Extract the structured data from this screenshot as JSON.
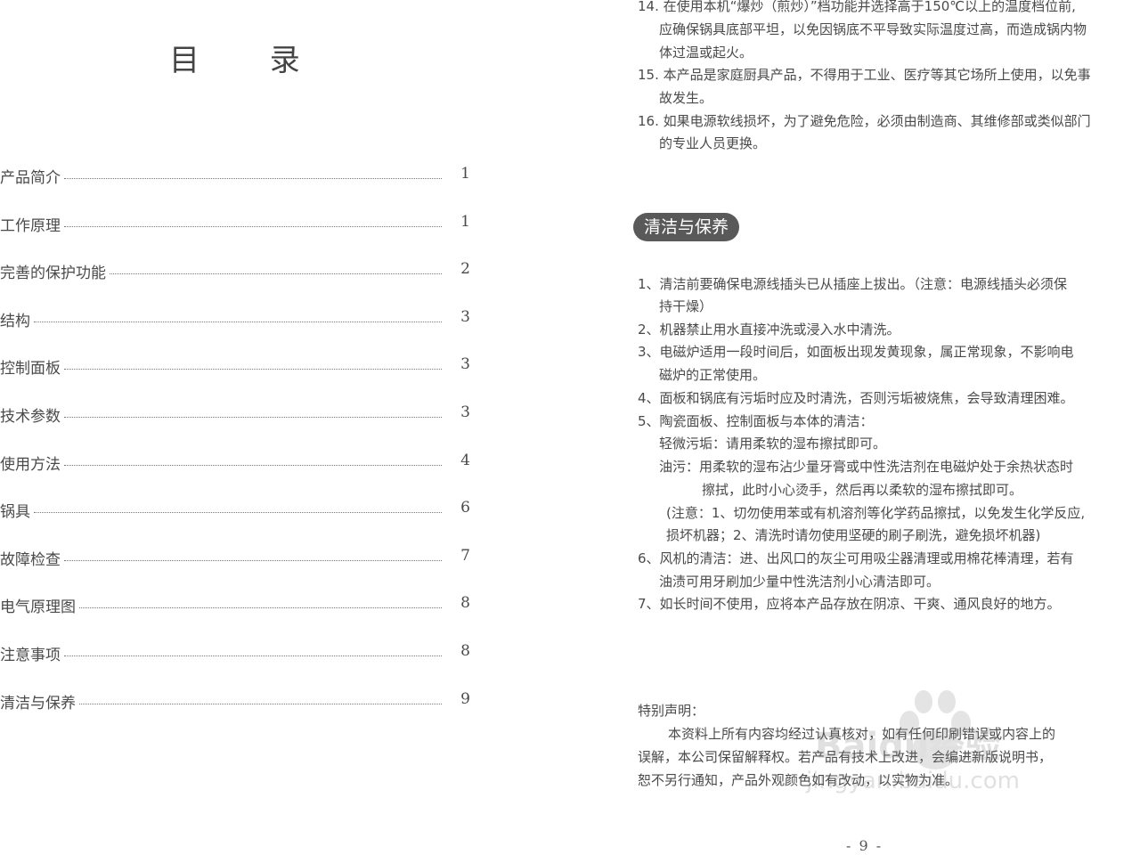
{
  "toc": {
    "title": "目 录",
    "entries": [
      {
        "label": "产品简介",
        "page": "1"
      },
      {
        "label": "工作原理",
        "page": "1"
      },
      {
        "label": "完善的保护功能",
        "page": "2"
      },
      {
        "label": "结构",
        "page": "3"
      },
      {
        "label": "控制面板",
        "page": "3"
      },
      {
        "label": "技术参数",
        "page": "3"
      },
      {
        "label": "使用方法",
        "page": "4"
      },
      {
        "label": "锅具",
        "page": "6"
      },
      {
        "label": "故障检查",
        "page": "7"
      },
      {
        "label": "电气原理图",
        "page": "8"
      },
      {
        "label": "注意事项",
        "page": "8"
      },
      {
        "label": "清洁与保养",
        "page": "9"
      }
    ]
  },
  "right": {
    "top_lines": [
      "14. 在使用本机“爆炒（煎炒）”档功能并选择高于150℃以上的温度档位前,",
      "应确保锅具底部平坦，以免因锅底不平导致实际温度过高，而造成锅内物",
      "体过温或起火。",
      "15. 本产品是家庭厨具产品，不得用于工业、医疗等其它场所上使用，以免事",
      "故发生。",
      "16. 如果电源软线损坏，为了避免危险，必须由制造商、其维修部或类似部门",
      "的专业人员更换。"
    ],
    "section_title": "清洁与保养",
    "clean_lines": [
      "1、清洁前要确保电源线插头已从插座上拔出。（注意：电源线插头必须保",
      "持干燥）",
      "2、机器禁止用水直接冲洗或浸入水中清洗。",
      "3、电磁炉适用一段时间后，如面板出现发黄现象，属正常现象，不影响电",
      "磁炉的正常使用。",
      "4、面板和锅底有污垢时应及时清洗，否则污垢被烧焦，会导致清理困难。",
      "5、陶瓷面板、控制面板与本体的清洁：",
      "轻微污垢：请用柔软的湿布擦拭即可。",
      "油污：用柔软的湿布沾少量牙膏或中性洗洁剂在电磁炉处于余热状态时",
      "擦拭，此时小心烫手，然后再以柔软的湿布擦拭即可。",
      "(注意：1、切勿使用苯或有机溶剂等化学药品擦拭，以免发生化学反应,",
      "损坏机器；2、清洗时请勿使用坚硬的刷子刷洗，避免损坏机器)",
      "6、风机的清洁：进、出风口的灰尘可用吸尘器清理或用棉花棒清理，若有",
      "油渍可用牙刷加少量中性洗洁剂小心清洁即可。",
      "7、如长时间不使用，应将本产品存放在阴凉、干爽、通风良好的地方。"
    ],
    "notice_title": "特别声明：",
    "notice_lines": [
      "本资料上所有内容均经过认真核对，如有任何印刷错误或内容上的",
      "误解，本公司保留解释权。若产品有技术上改进，会编进新版说明书，",
      "恕不另行通知，产品外观颜色如有改动，以实物为准。"
    ],
    "page_number": "- 9 -"
  },
  "watermark": {
    "brand": "Baidu经验",
    "url": "jingyan.baidu.com"
  }
}
